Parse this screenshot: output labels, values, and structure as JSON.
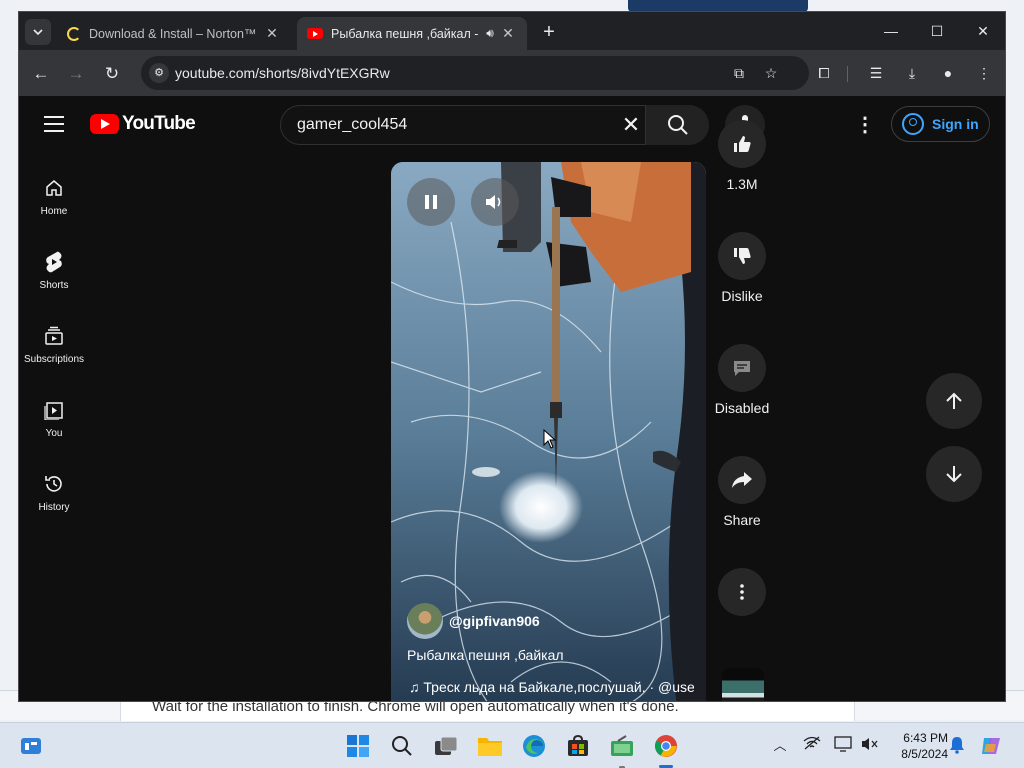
{
  "background_page": {
    "instruction_text": "Wait for the installation to finish. Chrome will open automatically when it's done."
  },
  "browser": {
    "tabs": [
      {
        "title": "Download & Install – Norton™",
        "state": "loading"
      },
      {
        "title": "Рыбалка пешня ,байкал - Y",
        "state": "active",
        "audio": true
      }
    ],
    "url": "youtube.com/shorts/8ivdYtEXGRw",
    "colors": {
      "tabbar": "#202124",
      "toolbar": "#35363a"
    }
  },
  "youtube": {
    "brand": "YouTube",
    "search": {
      "query": "gamer_cool454"
    },
    "signin_label": "Sign in",
    "sidebar": [
      {
        "label": "Home",
        "icon": "home-icon"
      },
      {
        "label": "Shorts",
        "icon": "shorts-icon"
      },
      {
        "label": "Subscriptions",
        "icon": "subscriptions-icon"
      },
      {
        "label": "You",
        "icon": "you-icon"
      },
      {
        "label": "History",
        "icon": "history-icon"
      }
    ],
    "short": {
      "channel": "@gipfivan906",
      "title": "Рыбалка пешня ,байкал",
      "music": "♫ Треск льда на Байкале,послушай. · @user"
    },
    "actions": {
      "likes": "1.3M",
      "dislike": "Dislike",
      "comments": "Disabled",
      "share": "Share"
    },
    "colors": {
      "accent": "#ff0000",
      "link": "#3ea6ff",
      "page": "#0f0f0f"
    }
  },
  "taskbar": {
    "time": "6:43 PM",
    "date": "8/5/2024",
    "pinned": [
      "widgets-icon",
      "start-icon",
      "search-icon",
      "task-view-icon",
      "file-explorer-icon",
      "edge-icon",
      "store-icon",
      "app-icon",
      "chrome-icon"
    ]
  }
}
